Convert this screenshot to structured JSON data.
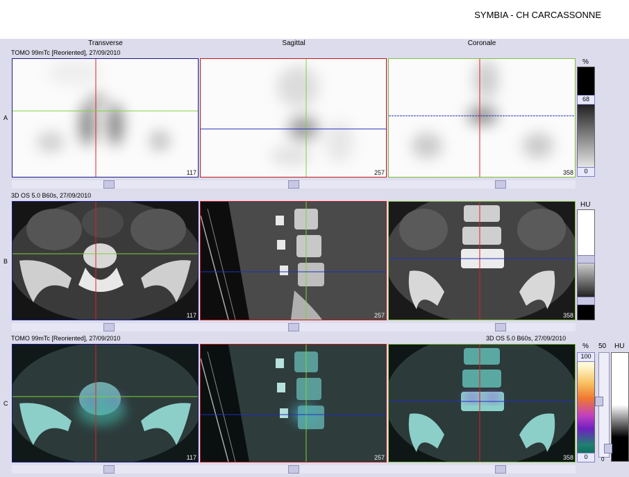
{
  "header": {
    "title": "SYMBIA - CH CARCASSONNE"
  },
  "columns": [
    "Transverse",
    "Sagittal",
    "Coronale"
  ],
  "rows": {
    "a": {
      "letter": "A",
      "label": "TOMO 99mTc [Reoriented], 27/09/2010"
    },
    "b": {
      "letter": "B",
      "label": "3D  OS  5.0  B60s, 27/09/2010"
    },
    "c": {
      "letter": "C",
      "label": "TOMO 99mTc [Reoriented], 27/09/2010",
      "label_right": "3D  OS  5.0  B60s, 27/09/2010"
    }
  },
  "slices": [
    "117",
    "257",
    "358"
  ],
  "scales": {
    "a": {
      "unit": "%",
      "top": "68",
      "bottom": "0"
    },
    "b": {
      "unit": "HU"
    },
    "c": {
      "unit": "%",
      "top": "100",
      "bottom": "0",
      "mid": "50",
      "unit2": "HU",
      "bottom2": "0"
    }
  },
  "colors": {
    "transverse_border": "#1a1a8a",
    "sagittal_border": "#c01818",
    "coronal_border": "#7ec03a",
    "crosshair_red": "#e02020",
    "crosshair_green": "#7ed23a",
    "crosshair_blue": "#2030c0"
  }
}
